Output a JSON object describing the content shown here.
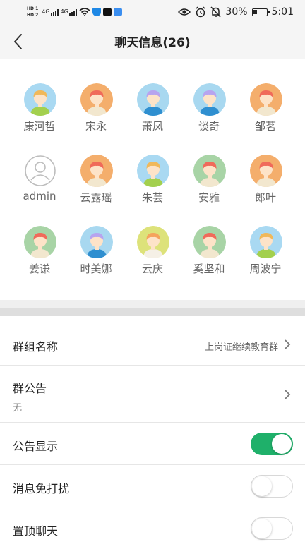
{
  "status_bar": {
    "hd1": "HD 1",
    "hd2": "HD 2",
    "net1": "4G",
    "net2": "4G",
    "battery": "30%",
    "time": "5:01",
    "app_icon_colors": [
      "#1e88e5",
      "#111111",
      "#3a8ef0"
    ]
  },
  "header": {
    "title": "聊天信息(26)"
  },
  "members": [
    {
      "name": "康河哲",
      "avatar": "boy-blue"
    },
    {
      "name": "宋永",
      "avatar": "girl-orange"
    },
    {
      "name": "萧凤",
      "avatar": "boy-purple"
    },
    {
      "name": "谈奇",
      "avatar": "boy-purple"
    },
    {
      "name": "邹茗",
      "avatar": "girl-orange"
    },
    {
      "name": "admin",
      "avatar": "default-user"
    },
    {
      "name": "云露瑶",
      "avatar": "girl-orange"
    },
    {
      "name": "朱芸",
      "avatar": "boy-blue"
    },
    {
      "name": "安雅",
      "avatar": "girl-green"
    },
    {
      "name": "郎叶",
      "avatar": "girl-orange"
    },
    {
      "name": "姜谦",
      "avatar": "girl-green"
    },
    {
      "name": "时美娜",
      "avatar": "boy-purple"
    },
    {
      "name": "云庆",
      "avatar": "boy-lime"
    },
    {
      "name": "奚坚和",
      "avatar": "girl-green"
    },
    {
      "name": "周波宁",
      "avatar": "boy-blue"
    }
  ],
  "settings": {
    "group_name": {
      "label": "群组名称",
      "value": "上岗证继续教育群"
    },
    "announcement": {
      "label": "群公告",
      "value": "无"
    },
    "show_announcement": {
      "label": "公告显示",
      "on": true
    },
    "mute": {
      "label": "消息免打扰",
      "on": false
    },
    "pin": {
      "label": "置顶聊天",
      "on": false
    }
  },
  "colors": {
    "accent_toggle_on": "#1fb06a",
    "avatar_bg_blue": "#a9d9f2",
    "avatar_bg_orange": "#f4ae6c",
    "avatar_bg_purple": "#a8d8f0",
    "avatar_bg_green": "#a8d4a6",
    "avatar_bg_lime": "#dde27a"
  }
}
